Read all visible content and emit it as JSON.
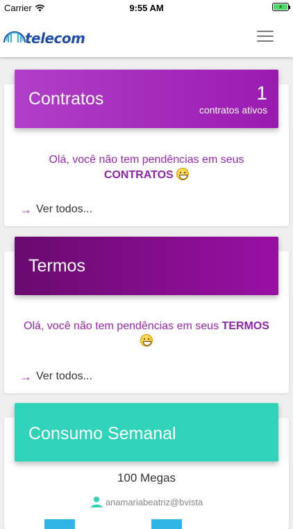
{
  "status_bar": {
    "carrier": "Carrier",
    "time": "9:55 AM",
    "battery_color": "#4cd964"
  },
  "header": {
    "logo_text": "telecom",
    "logo_icon": "globe-logo-icon",
    "menu_icon": "hamburger-menu-icon",
    "brand_color": "#1f4ea8"
  },
  "contratos": {
    "title": "Contratos",
    "count": "1",
    "count_label": "contratos ativos",
    "message_prefix": "Olá, você não tem pendências em seus",
    "message_highlight": "CONTRATOS",
    "see_all": "Ver todos...",
    "gradient": [
      "#b13fc8",
      "#9a1ab0"
    ]
  },
  "termos": {
    "title": "Termos",
    "message_prefix": "Olá, você não tem pendências em seus",
    "message_highlight": "TERMOS",
    "see_all": "Ver todos...",
    "gradient": [
      "#6a0a6f",
      "#9910a4"
    ]
  },
  "consumo": {
    "title": "Consumo Semanal",
    "value": "100 Megas",
    "user": "anamariabeatriz@bvista",
    "user_icon": "person-icon",
    "color": "#2fd3b9"
  }
}
